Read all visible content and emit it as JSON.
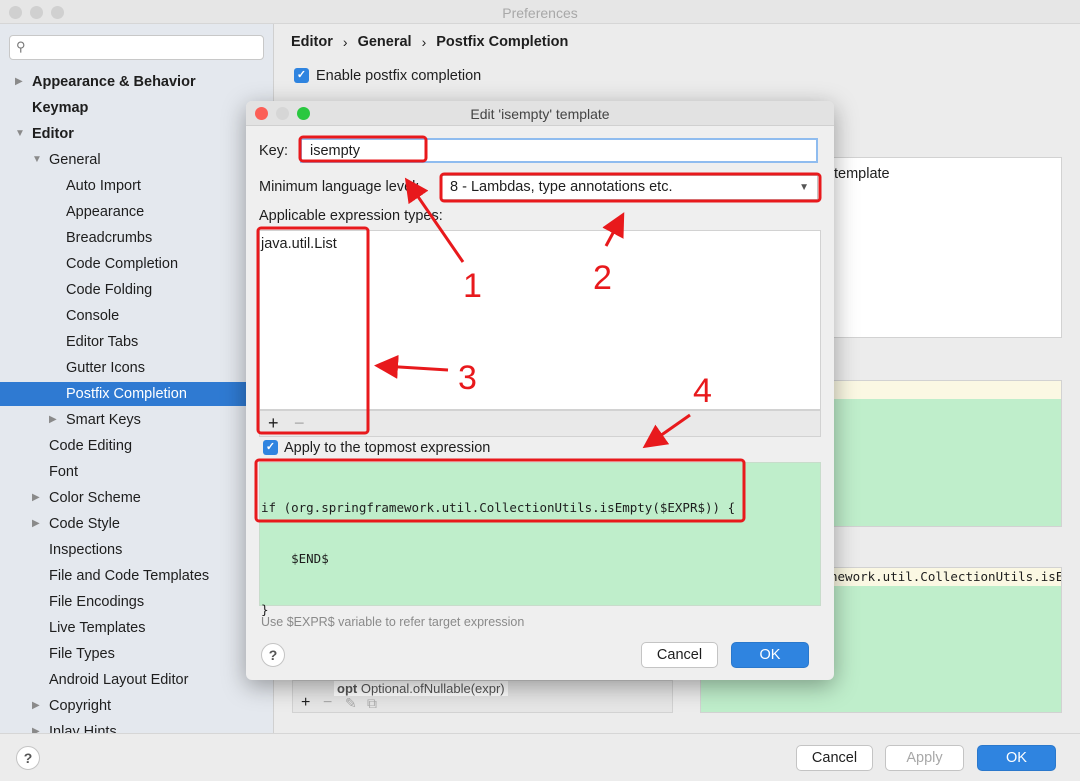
{
  "window": {
    "title": "Preferences"
  },
  "sidebar": {
    "search_placeholder": "",
    "items": [
      {
        "label": "Appearance & Behavior",
        "bold": true
      },
      {
        "label": "Keymap",
        "bold": true
      },
      {
        "label": "Editor",
        "bold": true
      },
      {
        "label": "General"
      },
      {
        "label": "Auto Import"
      },
      {
        "label": "Appearance"
      },
      {
        "label": "Breadcrumbs"
      },
      {
        "label": "Code Completion"
      },
      {
        "label": "Code Folding"
      },
      {
        "label": "Console"
      },
      {
        "label": "Editor Tabs"
      },
      {
        "label": "Gutter Icons"
      },
      {
        "label": "Postfix Completion",
        "selected": true
      },
      {
        "label": "Smart Keys"
      },
      {
        "label": "Code Editing"
      },
      {
        "label": "Font"
      },
      {
        "label": "Color Scheme"
      },
      {
        "label": "Code Style"
      },
      {
        "label": "Inspections"
      },
      {
        "label": "File and Code Templates"
      },
      {
        "label": "File Encodings"
      },
      {
        "label": "Live Templates"
      },
      {
        "label": "File Types"
      },
      {
        "label": "Android Layout Editor"
      },
      {
        "label": "Copyright"
      },
      {
        "label": "Inlay Hints"
      }
    ]
  },
  "main": {
    "breadcrumb": [
      "Editor",
      "General",
      "Postfix Completion"
    ],
    "breadcrumb_sep": "›",
    "enable_label": "Enable postfix completion",
    "enable_checked": true,
    "description_partial": "template",
    "code_partial": "nework.util.CollectionUtils.isE",
    "list_partial_key": "opt",
    "list_partial_value": "Optional.ofNullable(expr)",
    "toolbar": {
      "add": "+",
      "remove": "−"
    }
  },
  "dialog": {
    "title": "Edit 'isempty' template",
    "key_label": "Key:",
    "key_value": "isempty",
    "lang_label": "Minimum language level:",
    "lang_value": "8 - Lambdas, type annotations etc.",
    "types_label": "Applicable expression types:",
    "types": [
      "java.util.List"
    ],
    "add": "+",
    "remove": "−",
    "apply_topmost_label": "Apply to the topmost expression",
    "apply_topmost_checked": true,
    "code_lines": [
      "if (org.springframework.util.CollectionUtils.isEmpty($EXPR$)) {",
      "    $END$",
      "}"
    ],
    "hint": "Use $EXPR$ variable to refer target expression",
    "help": "?",
    "cancel": "Cancel",
    "ok": "OK"
  },
  "footer": {
    "help": "?",
    "cancel": "Cancel",
    "apply": "Apply",
    "ok": "OK"
  },
  "annotations": [
    "1",
    "2",
    "3",
    "4"
  ],
  "colors": {
    "accent": "#2f84e0",
    "selection": "#2f7ad2",
    "annotation": "#e8191c",
    "code_bg": "#bfeecb"
  }
}
